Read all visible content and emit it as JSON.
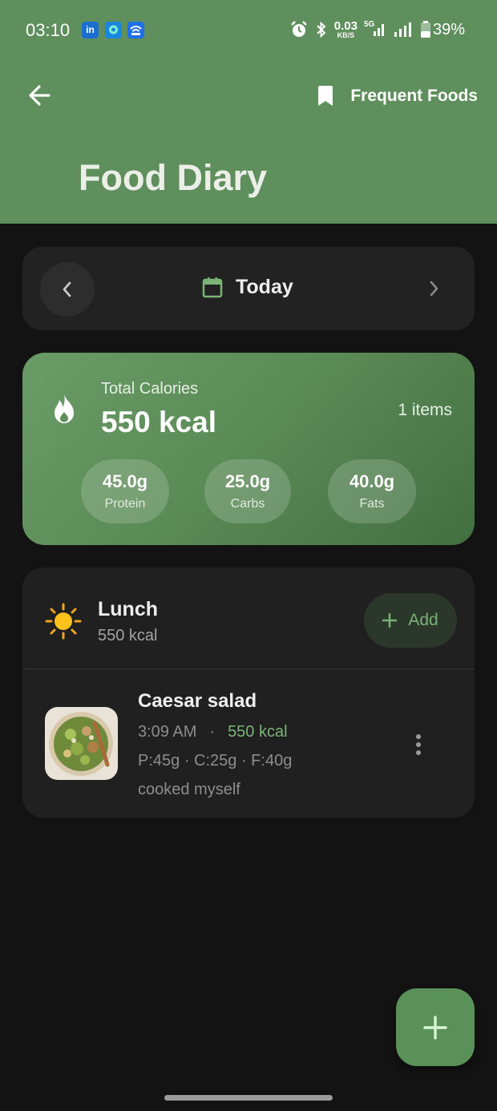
{
  "status_bar": {
    "time": "03:10",
    "apps": [
      "linkedin-icon",
      "chat-app-icon",
      "wifi-app-icon"
    ],
    "net_rate_value": "0.03",
    "net_rate_unit": "KB/S",
    "network_label": "5G",
    "battery": "39%"
  },
  "header": {
    "back_icon": "arrow-left-icon",
    "frequent_foods_label": "Frequent Foods",
    "title": "Food Diary"
  },
  "date_nav": {
    "label": "Today"
  },
  "summary": {
    "total_label": "Total Calories",
    "total_value": "550 kcal",
    "items_count": "1 items",
    "macros": [
      {
        "value": "45.0g",
        "label": "Protein"
      },
      {
        "value": "25.0g",
        "label": "Carbs"
      },
      {
        "value": "40.0g",
        "label": "Fats"
      }
    ]
  },
  "meal": {
    "name": "Lunch",
    "kcal": "550 kcal",
    "add_label": "Add",
    "items": [
      {
        "name": "Caesar salad",
        "time": "3:09 AM",
        "separator": "·",
        "kcal": "550 kcal",
        "macros": "P:45g · C:25g · F:40g",
        "note": "cooked myself"
      }
    ]
  },
  "colors": {
    "header_bg": "#5e8f5c",
    "accent_green": "#7cb478",
    "background": "#131313",
    "card_bg": "#202020"
  }
}
